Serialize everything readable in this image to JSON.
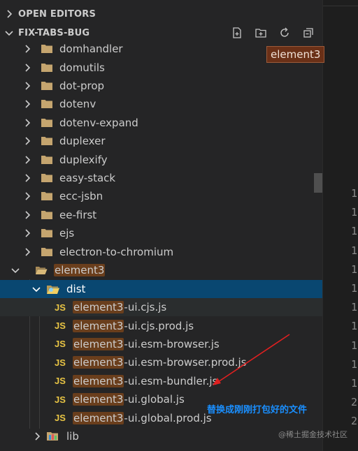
{
  "explorer": {
    "open_editors_label": "OPEN EDITORS",
    "workspace_label": "FIX-TABS-BUG",
    "toolbar_icons": [
      "new-file-icon",
      "new-folder-icon",
      "refresh-icon",
      "collapse-all-icon"
    ]
  },
  "tree": {
    "folders": [
      {
        "label": "domhandler"
      },
      {
        "label": "domutils"
      },
      {
        "label": "dot-prop"
      },
      {
        "label": "dotenv"
      },
      {
        "label": "dotenv-expand"
      },
      {
        "label": "duplexer"
      },
      {
        "label": "duplexify"
      },
      {
        "label": "easy-stack"
      },
      {
        "label": "ecc-jsbn"
      },
      {
        "label": "ee-first"
      },
      {
        "label": "ejs"
      },
      {
        "label": "electron-to-chromium"
      }
    ],
    "open_folder": {
      "label": "element3"
    },
    "dist_folder": {
      "label": "dist"
    },
    "files": [
      {
        "type_label": "JS",
        "highlight": "element3",
        "rest": "-ui.cjs.js"
      },
      {
        "type_label": "JS",
        "highlight": "element3",
        "rest": "-ui.cjs.prod.js"
      },
      {
        "type_label": "JS",
        "highlight": "element3",
        "rest": "-ui.esm-browser.js"
      },
      {
        "type_label": "JS",
        "highlight": "element3",
        "rest": "-ui.esm-browser.prod.js"
      },
      {
        "type_label": "JS",
        "highlight": "element3",
        "rest": "-ui.esm-bundler.js"
      },
      {
        "type_label": "JS",
        "highlight": "element3",
        "rest": "-ui.global.js"
      },
      {
        "type_label": "JS",
        "highlight": "element3",
        "rest": "-ui.global.prod.js"
      }
    ],
    "lib_folder": {
      "label": "lib"
    }
  },
  "tooltip": {
    "text": "element3"
  },
  "editor": {
    "line_numbers": [
      "1",
      "1",
      "1",
      "1",
      "1",
      "1",
      "1",
      "1",
      "1",
      "1",
      "1",
      "2",
      "2"
    ]
  },
  "annotation": {
    "text": "替换成刚刚打包好的文件",
    "color": "#1a8fff",
    "arrow_color": "#e02020"
  },
  "watermark": {
    "text": "@稀土掘金技术社区"
  },
  "colors": {
    "selected": "#094771",
    "highlight": "#6a3e1c",
    "js_badge": "#e8c444",
    "folder": "#c5a56f"
  }
}
